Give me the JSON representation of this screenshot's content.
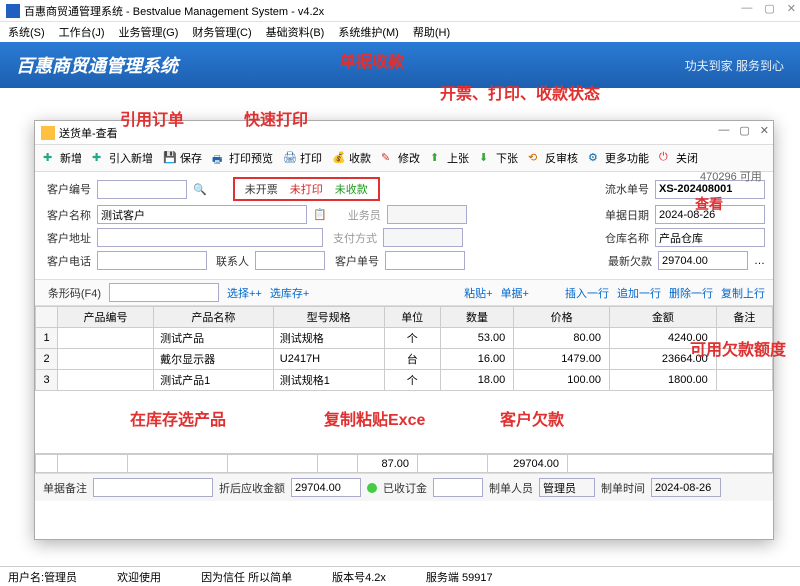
{
  "app": {
    "title": "百惠商贸通管理系统 - Bestvalue Management System - v4.2x",
    "banner_title": "百惠商贸通管理系统",
    "banner_slogan": "功夫到家 服务到心"
  },
  "menu": {
    "items": [
      "系统(S)",
      "工作台(J)",
      "业务管理(G)",
      "财务管理(C)",
      "基础资料(B)",
      "系统维护(M)",
      "帮助(H)"
    ]
  },
  "dialog": {
    "title": "送货单-查看"
  },
  "toolbar": {
    "new": "新增",
    "new_ref": "引入新增",
    "save": "保存",
    "preview": "打印预览",
    "print": "打印",
    "collect": "收款",
    "edit": "修改",
    "prev": "上张",
    "next": "下张",
    "unreview": "反审核",
    "more": "更多功能",
    "close": "关闭"
  },
  "status": {
    "not_invoiced": "未开票",
    "not_printed": "未打印",
    "not_paid": "未收款"
  },
  "form": {
    "cust_code_lbl": "客户编号",
    "cust_code": "",
    "doc_no_lbl": "流水单号",
    "doc_no": "XS-202408001",
    "cust_name_lbl": "客户名称",
    "cust_name": "测试客户",
    "sales_lbl": "业务员",
    "doc_date_lbl": "单据日期",
    "doc_date": "2024-08-26",
    "cust_addr_lbl": "客户地址",
    "pay_method_lbl": "支付方式",
    "warehouse_lbl": "仓库名称",
    "warehouse": "产品仓库",
    "cust_phone_lbl": "客户电话",
    "contact_lbl": "联系人",
    "cust_order_lbl": "客户单号",
    "latest_debt_lbl": "最新欠款",
    "latest_debt": "29704.00",
    "barcode_lbl": "条形码(F4)"
  },
  "action_links": {
    "select_pp": "选择++",
    "select_stock": "选库存+",
    "paste": "粘贴+",
    "single": "单据+",
    "insert_row": "插入一行",
    "append_row": "追加一行",
    "delete_row": "删除一行",
    "copy_row": "复制上行"
  },
  "grid": {
    "headers": [
      "",
      "产品编号",
      "产品名称",
      "型号规格",
      "单位",
      "数量",
      "价格",
      "金额",
      "备注"
    ],
    "rows": [
      {
        "idx": "1",
        "code": "",
        "name": "测试产品",
        "spec": "测试规格",
        "unit": "个",
        "qty": "53.00",
        "price": "80.00",
        "amount": "4240.00"
      },
      {
        "idx": "2",
        "code": "",
        "name": "戴尔显示器",
        "spec": "U2417H",
        "unit": "台",
        "qty": "16.00",
        "price": "1479.00",
        "amount": "23664.00"
      },
      {
        "idx": "3",
        "code": "",
        "name": "测试产品1",
        "spec": "测试规格1",
        "unit": "个",
        "qty": "18.00",
        "price": "100.00",
        "amount": "1800.00"
      }
    ],
    "totals": {
      "qty": "87.00",
      "amount": "29704.00"
    }
  },
  "footer": {
    "remark_lbl": "单据备注",
    "discount_lbl": "折后应收金额",
    "discount": "29704.00",
    "deposit_lbl": "已收订金",
    "maker_lbl": "制单人员",
    "maker": "管理员",
    "make_time_lbl": "制单时间",
    "make_time": "2024-08-26"
  },
  "avail": {
    "text": "470296 可用"
  },
  "annotations": {
    "ref_order": "引用订单",
    "quick_print": "快速打印",
    "doc_collect": "单据收款",
    "status_anno": "开票、打印、收款状态",
    "select_in_stock": "在库存选产品",
    "paste_excel": "复制粘贴Exce",
    "cust_debt": "客户欠款",
    "avail_credit": "可用欠款额度",
    "view": "查看"
  },
  "statusbar": {
    "user_lbl": "用户名:",
    "user": "管理员",
    "welcome": "欢迎使用",
    "trust": "因为信任 所以简单",
    "version_lbl": "版本号",
    "version": "4.2x",
    "server_lbl": "服务端",
    "server": "59917"
  }
}
